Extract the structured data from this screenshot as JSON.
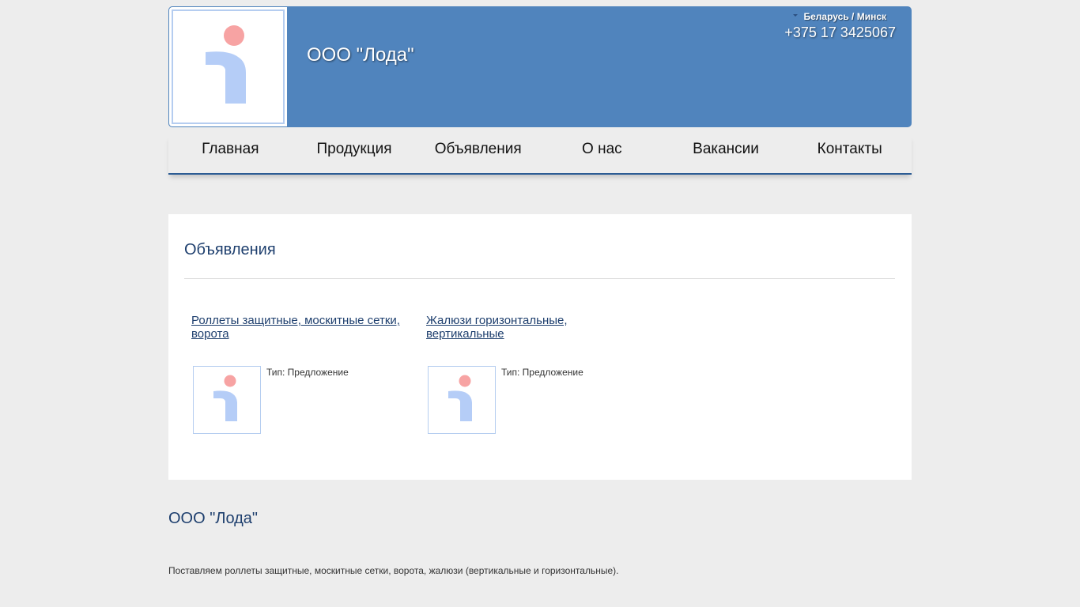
{
  "header": {
    "logo_icon": "info-i-logo",
    "company_name": "ООО \"Лода\"",
    "region": "Беларусь / Минск",
    "phone": "+375 17 3425067",
    "bg_color": "#5084bd"
  },
  "nav": {
    "items": [
      {
        "label": "Главная"
      },
      {
        "label": "Продукция"
      },
      {
        "label": "Объявления"
      },
      {
        "label": "О нас"
      },
      {
        "label": "Вакансии"
      },
      {
        "label": "Контакты"
      }
    ]
  },
  "main": {
    "title": "Объявления",
    "ads": [
      {
        "title": "Роллеты защитные, москитные сетки, ворота",
        "type_label": "Тип: Предложение",
        "thumb_icon": "info-i-logo"
      },
      {
        "title": "Жалюзи горизонтальные, вертикальные",
        "type_label": "Тип: Предложение",
        "thumb_icon": "info-i-logo"
      }
    ]
  },
  "footer": {
    "title": "ООО \"Лода\"",
    "description": "Поставляем роллеты защитные, москитные сетки, ворота, жалюзи (вертикальные и горизонтальные)."
  },
  "colors": {
    "accent": "#1e3f6e",
    "logo_dot": "#f7a3a3",
    "logo_stem": "#b5cdf7"
  }
}
